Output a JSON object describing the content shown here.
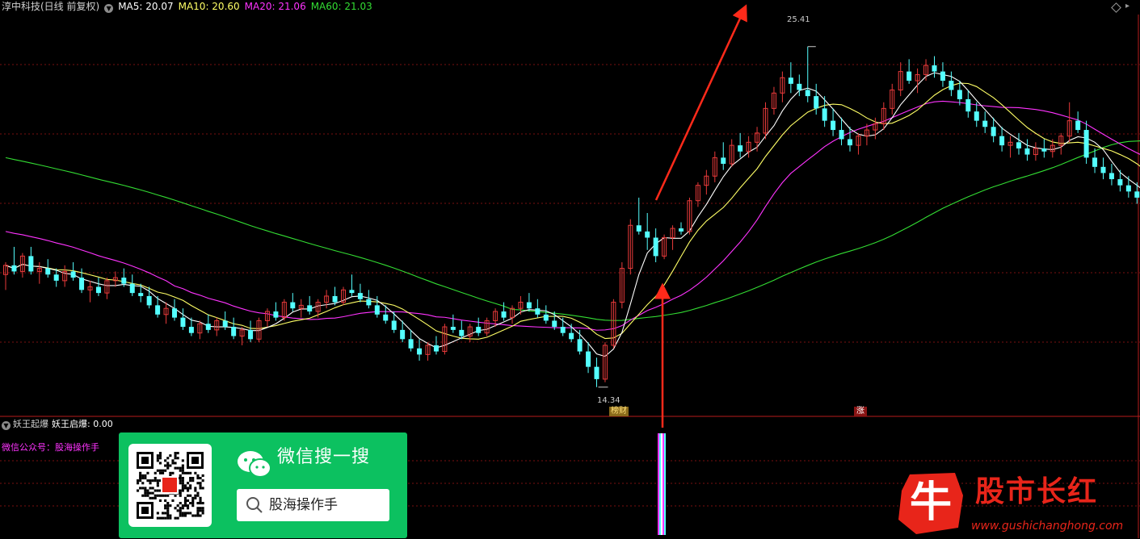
{
  "header": {
    "stock_title": "淳中科技(日线 前复权)",
    "ma5": "MA5: 20.07",
    "ma10": "MA10: 20.60",
    "ma20": "MA20: 21.06",
    "ma60": "MA60: 21.03"
  },
  "price_chart": {
    "high_label": "25.41",
    "low_label": "14.34",
    "badge_left": "榜财",
    "badge_right": "涨",
    "colors": {
      "up": "#e83a3a",
      "down": "#54ffff",
      "ma5": "#ffffff",
      "ma10": "#ffff66",
      "ma20": "#ff33ff",
      "ma60": "#33dd33",
      "arrow": "#ff2a1a",
      "grid": "#7a1010",
      "divider": "#b81c1c"
    }
  },
  "indicator": {
    "name": "妖王起爆",
    "value_text": "妖王启爆: 0.00",
    "wechat_label": "微信公众号：股海操作手"
  },
  "wechat_banner": {
    "title": "微信搜一搜",
    "search_text": "股海操作手"
  },
  "brand": {
    "logo_char": "牛",
    "name": "股市长红",
    "url": "www.gushichanghong.com"
  },
  "chart_data": {
    "type": "candlestick",
    "title": "淳中科技(日线 前复权)",
    "series": [
      {
        "name": "MA5",
        "last": 20.07
      },
      {
        "name": "MA10",
        "last": 20.6
      },
      {
        "name": "MA20",
        "last": 21.06
      },
      {
        "name": "MA60",
        "last": 21.03
      }
    ],
    "annotations": {
      "high": 25.41,
      "low": 14.34
    },
    "candles": [
      [
        18.0,
        18.4,
        17.5,
        18.3
      ],
      [
        18.3,
        18.9,
        18.0,
        18.1
      ],
      [
        18.1,
        18.7,
        17.9,
        18.6
      ],
      [
        18.6,
        18.9,
        18.0,
        18.1
      ],
      [
        18.1,
        18.4,
        17.7,
        18.2
      ],
      [
        18.2,
        18.5,
        17.9,
        18.0
      ],
      [
        18.0,
        18.2,
        17.6,
        17.8
      ],
      [
        17.8,
        18.3,
        17.6,
        18.1
      ],
      [
        18.1,
        18.4,
        17.8,
        17.9
      ],
      [
        17.9,
        18.2,
        17.4,
        17.5
      ],
      [
        17.5,
        17.8,
        17.1,
        17.6
      ],
      [
        17.6,
        17.9,
        17.3,
        17.4
      ],
      [
        17.4,
        17.9,
        17.2,
        17.8
      ],
      [
        17.8,
        18.1,
        17.6,
        17.9
      ],
      [
        17.9,
        18.2,
        17.6,
        17.7
      ],
      [
        17.7,
        18.0,
        17.3,
        17.4
      ],
      [
        17.4,
        17.7,
        17.1,
        17.3
      ],
      [
        17.3,
        17.6,
        16.9,
        17.0
      ],
      [
        17.0,
        17.3,
        16.6,
        16.7
      ],
      [
        16.7,
        17.1,
        16.4,
        16.9
      ],
      [
        16.9,
        17.2,
        16.5,
        16.6
      ],
      [
        16.6,
        16.9,
        16.2,
        16.3
      ],
      [
        16.3,
        16.6,
        16.0,
        16.1
      ],
      [
        16.1,
        16.5,
        15.9,
        16.4
      ],
      [
        16.4,
        16.7,
        16.1,
        16.2
      ],
      [
        16.2,
        16.6,
        16.0,
        16.5
      ],
      [
        16.5,
        16.8,
        16.2,
        16.3
      ],
      [
        16.3,
        16.6,
        15.9,
        16.0
      ],
      [
        16.0,
        16.3,
        15.7,
        16.2
      ],
      [
        16.2,
        16.5,
        15.8,
        15.9
      ],
      [
        15.9,
        16.6,
        15.8,
        16.5
      ],
      [
        16.5,
        16.9,
        16.3,
        16.8
      ],
      [
        16.8,
        17.1,
        16.5,
        16.6
      ],
      [
        16.6,
        17.2,
        16.5,
        17.1
      ],
      [
        17.1,
        17.4,
        16.8,
        16.9
      ],
      [
        16.9,
        17.2,
        16.6,
        17.0
      ],
      [
        17.0,
        17.3,
        16.7,
        16.8
      ],
      [
        16.8,
        17.2,
        16.6,
        17.1
      ],
      [
        17.1,
        17.5,
        16.9,
        17.3
      ],
      [
        17.3,
        17.6,
        17.0,
        17.1
      ],
      [
        17.1,
        17.6,
        17.0,
        17.5
      ],
      [
        17.5,
        18.0,
        17.3,
        17.4
      ],
      [
        17.4,
        17.7,
        17.1,
        17.2
      ],
      [
        17.2,
        17.5,
        16.9,
        17.0
      ],
      [
        17.0,
        17.3,
        16.6,
        16.7
      ],
      [
        16.7,
        17.0,
        16.4,
        16.5
      ],
      [
        16.5,
        16.8,
        16.1,
        16.2
      ],
      [
        16.2,
        16.5,
        15.8,
        15.9
      ],
      [
        15.9,
        16.2,
        15.5,
        15.6
      ],
      [
        15.6,
        15.9,
        15.2,
        15.4
      ],
      [
        15.4,
        15.8,
        15.2,
        15.7
      ],
      [
        15.7,
        16.0,
        15.4,
        15.5
      ],
      [
        15.5,
        16.4,
        15.4,
        16.3
      ],
      [
        16.3,
        16.7,
        16.1,
        16.2
      ],
      [
        16.2,
        16.5,
        15.9,
        16.0
      ],
      [
        16.0,
        16.4,
        15.8,
        16.3
      ],
      [
        16.3,
        16.6,
        16.0,
        16.1
      ],
      [
        16.1,
        16.6,
        16.0,
        16.5
      ],
      [
        16.5,
        16.9,
        16.3,
        16.8
      ],
      [
        16.8,
        17.1,
        16.5,
        16.6
      ],
      [
        16.6,
        17.0,
        16.4,
        16.9
      ],
      [
        16.9,
        17.3,
        16.7,
        17.1
      ],
      [
        17.1,
        17.4,
        16.8,
        16.9
      ],
      [
        16.9,
        17.2,
        16.6,
        16.7
      ],
      [
        16.7,
        17.0,
        16.4,
        16.5
      ],
      [
        16.5,
        16.8,
        16.2,
        16.3
      ],
      [
        16.3,
        16.6,
        16.0,
        16.1
      ],
      [
        16.1,
        16.4,
        15.8,
        15.9
      ],
      [
        15.9,
        16.2,
        15.4,
        15.5
      ],
      [
        15.5,
        15.8,
        14.8,
        15.0
      ],
      [
        15.0,
        15.3,
        14.34,
        14.6
      ],
      [
        14.6,
        15.8,
        14.5,
        15.7
      ],
      [
        15.7,
        17.2,
        15.6,
        17.1
      ],
      [
        17.1,
        18.4,
        16.9,
        18.2
      ],
      [
        18.2,
        19.8,
        18.0,
        19.6
      ],
      [
        19.6,
        20.5,
        19.3,
        19.4
      ],
      [
        19.4,
        20.0,
        18.8,
        19.2
      ],
      [
        19.2,
        19.5,
        18.4,
        18.6
      ],
      [
        18.6,
        19.3,
        18.5,
        19.2
      ],
      [
        19.2,
        19.6,
        18.8,
        19.5
      ],
      [
        19.5,
        19.7,
        19.3,
        19.4
      ],
      [
        19.4,
        20.5,
        19.3,
        20.4
      ],
      [
        20.4,
        21.0,
        20.2,
        20.9
      ],
      [
        20.9,
        21.4,
        20.6,
        21.2
      ],
      [
        21.2,
        22.0,
        21.0,
        21.8
      ],
      [
        21.8,
        22.3,
        21.4,
        21.6
      ],
      [
        21.6,
        22.4,
        21.5,
        22.2
      ],
      [
        22.2,
        22.6,
        21.8,
        22.0
      ],
      [
        22.0,
        22.5,
        21.8,
        22.3
      ],
      [
        22.3,
        22.8,
        22.0,
        22.6
      ],
      [
        22.6,
        23.6,
        22.4,
        23.4
      ],
      [
        23.4,
        24.1,
        23.2,
        23.9
      ],
      [
        23.9,
        24.6,
        23.6,
        24.4
      ],
      [
        24.4,
        24.9,
        23.9,
        24.2
      ],
      [
        24.2,
        24.5,
        23.8,
        24.0
      ],
      [
        24.0,
        25.41,
        23.6,
        23.8
      ],
      [
        23.8,
        24.2,
        23.2,
        23.4
      ],
      [
        23.4,
        23.8,
        22.8,
        23.0
      ],
      [
        23.0,
        23.4,
        22.5,
        22.7
      ],
      [
        22.7,
        23.1,
        22.2,
        22.4
      ],
      [
        22.4,
        22.8,
        22.0,
        22.2
      ],
      [
        22.2,
        22.6,
        21.9,
        22.5
      ],
      [
        22.5,
        22.9,
        22.2,
        22.7
      ],
      [
        22.7,
        23.1,
        22.4,
        22.9
      ],
      [
        22.9,
        23.6,
        22.7,
        23.4
      ],
      [
        23.4,
        24.2,
        23.2,
        24.0
      ],
      [
        24.0,
        24.9,
        23.8,
        24.6
      ],
      [
        24.6,
        25.0,
        24.2,
        24.3
      ],
      [
        24.3,
        24.7,
        23.9,
        24.5
      ],
      [
        24.5,
        25.0,
        24.3,
        24.8
      ],
      [
        24.8,
        25.1,
        24.4,
        24.6
      ],
      [
        24.6,
        24.9,
        24.1,
        24.3
      ],
      [
        24.3,
        24.6,
        23.8,
        24.0
      ],
      [
        24.0,
        24.3,
        23.5,
        23.7
      ],
      [
        23.7,
        24.0,
        23.1,
        23.3
      ],
      [
        23.3,
        23.6,
        22.8,
        23.0
      ],
      [
        23.0,
        23.3,
        22.6,
        22.8
      ],
      [
        22.8,
        23.1,
        22.3,
        22.5
      ],
      [
        22.5,
        22.8,
        22.0,
        22.2
      ],
      [
        22.2,
        22.5,
        21.8,
        22.3
      ],
      [
        22.3,
        22.6,
        21.9,
        22.1
      ],
      [
        22.1,
        22.4,
        21.7,
        21.9
      ],
      [
        21.9,
        22.3,
        21.7,
        22.1
      ],
      [
        22.1,
        22.4,
        21.8,
        22.0
      ],
      [
        22.0,
        22.4,
        21.8,
        22.2
      ],
      [
        22.2,
        22.6,
        21.9,
        22.5
      ],
      [
        22.5,
        23.6,
        22.3,
        23.0
      ],
      [
        23.0,
        23.3,
        22.6,
        22.7
      ],
      [
        22.7,
        23.0,
        21.6,
        21.8
      ],
      [
        21.8,
        22.1,
        21.3,
        21.5
      ],
      [
        21.5,
        21.8,
        21.1,
        21.3
      ],
      [
        21.3,
        21.6,
        20.9,
        21.1
      ],
      [
        21.1,
        21.4,
        20.7,
        20.9
      ],
      [
        20.9,
        21.2,
        20.5,
        20.7
      ],
      [
        20.7,
        21.0,
        20.3,
        20.5
      ],
      [
        20.5,
        20.8,
        20.1,
        20.3
      ]
    ]
  }
}
